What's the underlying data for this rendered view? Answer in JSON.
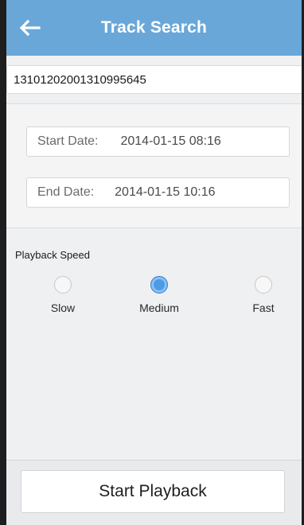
{
  "header": {
    "title": "Track Search",
    "back_icon": "arrow-left-icon"
  },
  "device": {
    "id": "13101202001310995645"
  },
  "dates": {
    "start_label": "Start Date:",
    "start_value": "2014-01-15 08:16",
    "end_label": "End Date:",
    "end_value": "2014-01-15 10:16"
  },
  "speed": {
    "label": "Playback Speed",
    "options": [
      {
        "label": "Slow",
        "selected": false
      },
      {
        "label": "Medium",
        "selected": true
      },
      {
        "label": "Fast",
        "selected": false
      }
    ]
  },
  "footer": {
    "button_label": "Start Playback"
  },
  "colors": {
    "header": "#6aa7d9",
    "radio_selected": "#4d9ae6"
  }
}
